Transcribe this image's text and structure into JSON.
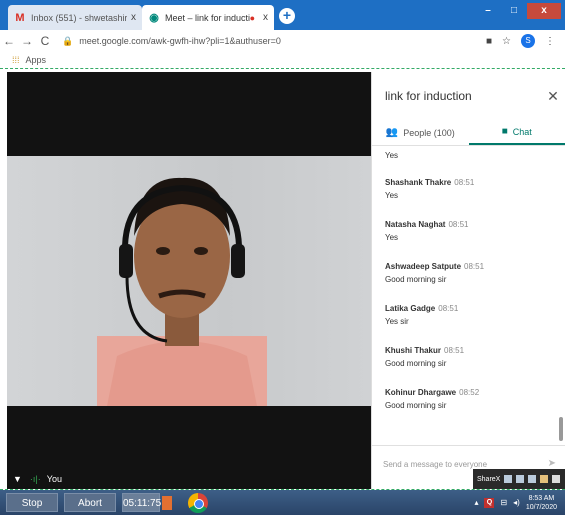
{
  "browser": {
    "tabs": [
      {
        "icon": "M",
        "title": "Inbox (551) - shwetashirpurkar2(",
        "close": "x"
      },
      {
        "icon": "◉",
        "title": "Meet – link for induction",
        "close": "x"
      }
    ],
    "new_tab": "+",
    "window": {
      "minimize": "–",
      "maximize": "□",
      "close": "x"
    },
    "url": "meet.google.com/awk-gwfh-ihw?pli=1&authuser=0",
    "profile_initial": "S",
    "bookmarks_label": "Apps"
  },
  "meet": {
    "self_label": "You",
    "panel_title": "link for induction",
    "tabs": {
      "people": "People (100)",
      "chat": "Chat"
    },
    "messages": [
      {
        "sender": "",
        "time": "",
        "text": "Yes"
      },
      {
        "sender": "Shashank Thakre",
        "time": "08:51",
        "text": "Yes"
      },
      {
        "sender": "Natasha Naghat",
        "time": "08:51",
        "text": "Yes"
      },
      {
        "sender": "Ashwadeep Satpute",
        "time": "08:51",
        "text": "Good morning sir"
      },
      {
        "sender": "Latika Gadge",
        "time": "08:51",
        "text": "Yes sir"
      },
      {
        "sender": "Khushi Thakur",
        "time": "08:51",
        "text": "Good morning sir"
      },
      {
        "sender": "Kohinur Dhargawe",
        "time": "08:52",
        "text": "Good morning sir"
      }
    ],
    "composer_placeholder": "Send a message to everyone"
  },
  "sharex": {
    "label": "ShareX"
  },
  "taskbar": {
    "stop": "Stop",
    "abort": "Abort",
    "timer": "05:11:75",
    "clock_time": "8:53 AM",
    "clock_date": "10/7/2020"
  }
}
